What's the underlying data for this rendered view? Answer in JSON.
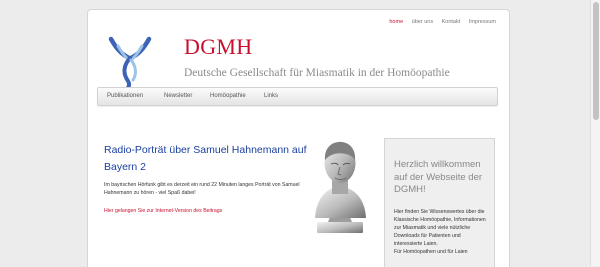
{
  "top_nav": {
    "items": [
      "home",
      "über uns",
      "Kontakt",
      "Impressum"
    ],
    "active_color": "#c8102e"
  },
  "site": {
    "title": "DGMH",
    "subtitle": "Deutsche Gesellschaft für Miasmatik in der Homöopathie"
  },
  "main_nav": {
    "items": [
      "Publikationen",
      "Newsletter",
      "Homöopathie",
      "Links"
    ]
  },
  "article": {
    "title": "Radio-Porträt über Samuel Hahnemann auf Bayern 2",
    "body": "Im bayrischen Hörfunk gibt es derzeit ein rund 22 Minuten langes Porträt von Samuel Hahnemann zu hören - viel Spaß dabei!",
    "link": "Hier gelangen Sie zur Internet-Version des Beitrags"
  },
  "sidebar": {
    "heading": "Herzlich willkommen auf der Webseite der DGMH!",
    "text_1": "Hier finden Sie Wissenswertes über die Klassische Homöopathie, Informationen zur Miasmatik und viele nützliche Downloads für Patienten und interessierte Laien.",
    "text_2": "Für Homöopathen und für Laien"
  },
  "colors": {
    "brand_red": "#c8102e",
    "link_blue": "#1a3fa0",
    "logo_blue": "#3d63b8",
    "logo_light_blue": "#9ec3e6"
  },
  "icons": {
    "logo": "dgmh-logo",
    "portrait": "hahnemann-bust"
  }
}
